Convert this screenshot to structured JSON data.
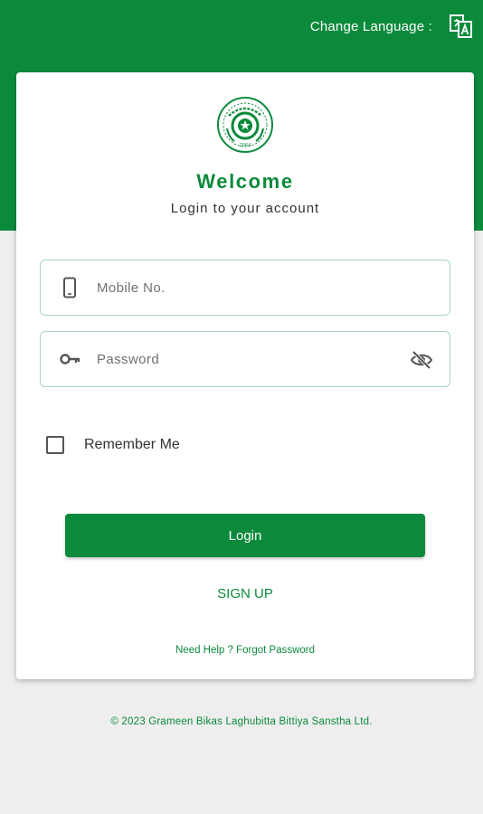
{
  "header": {
    "change_language_label": "Change Language :",
    "language_icon": "translate-icon"
  },
  "logo": {
    "icon": "organization-seal-logo",
    "year_text": "2064"
  },
  "login": {
    "welcome_title": "Welcome",
    "subtitle": "Login to your account",
    "mobile": {
      "placeholder": "Mobile No.",
      "value": "",
      "icon": "mobile-phone-icon"
    },
    "password": {
      "placeholder": "Password",
      "value": "",
      "icon": "key-icon",
      "toggle_icon": "visibility-off-icon"
    },
    "remember_me_label": "Remember Me",
    "remember_me_checked": false,
    "login_button_label": "Login",
    "signup_label": "SIGN UP",
    "help_label": "Need Help ? Forgot Password"
  },
  "footer": {
    "copyright": "© 2023 Grameen Bikas Laghubitta Bittiya Sanstha Ltd."
  },
  "colors": {
    "primary": "#0c8a3c",
    "background": "#eeeeee",
    "field_border": "#a6d7b8"
  }
}
